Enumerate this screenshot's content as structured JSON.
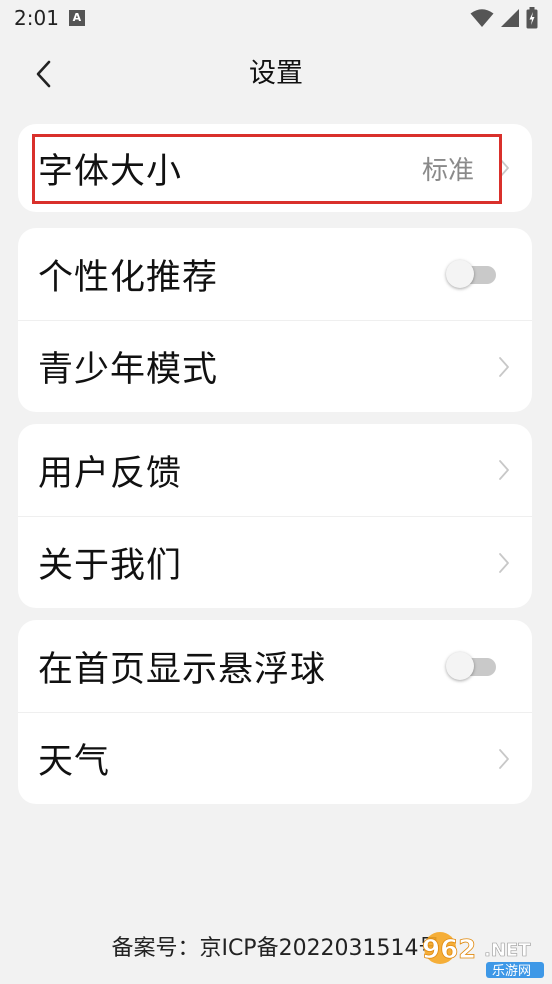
{
  "status_bar": {
    "time": "2:01",
    "notification_badge": "A"
  },
  "header": {
    "title": "设置"
  },
  "cards": [
    {
      "rows": [
        {
          "label": "字体大小",
          "value": "标准",
          "control": "chevron"
        }
      ]
    },
    {
      "rows": [
        {
          "label": "个性化推荐",
          "control": "toggle",
          "toggle_on": false
        },
        {
          "label": "青少年模式",
          "control": "chevron"
        }
      ]
    },
    {
      "rows": [
        {
          "label": "用户反馈",
          "control": "chevron"
        },
        {
          "label": "关于我们",
          "control": "chevron"
        }
      ]
    },
    {
      "rows": [
        {
          "label": "在首页显示悬浮球",
          "control": "toggle",
          "toggle_on": false
        },
        {
          "label": "天气",
          "control": "chevron"
        }
      ]
    }
  ],
  "footer": {
    "icp": "备案号：京ICP备2022031514号"
  },
  "watermark": {
    "number": "962",
    "suffix": ".NET",
    "caption": "乐游网"
  },
  "colors": {
    "background": "#f2f2f2",
    "card": "#ffffff",
    "highlight": "#d9302b",
    "value_text": "#8a8a8a"
  }
}
